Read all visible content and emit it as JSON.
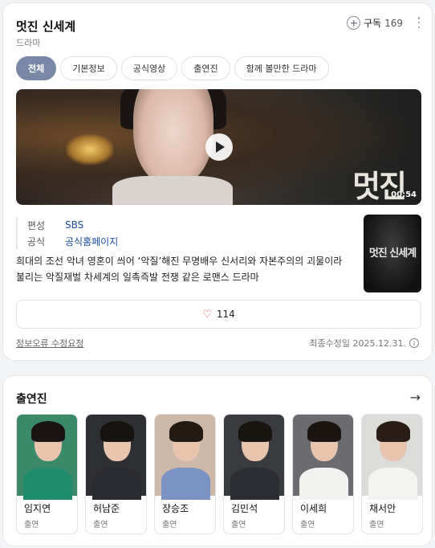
{
  "header": {
    "title": "멋진 신세계",
    "subtitle": "드라마",
    "subscribe_label": "구독",
    "subscribe_count": "169"
  },
  "tabs": [
    "전체",
    "기본정보",
    "공식영상",
    "출연진",
    "함께 볼만한 드라마"
  ],
  "active_tab": "전체",
  "video": {
    "duration": "00:54",
    "overlay_title": "멋진"
  },
  "info": [
    {
      "key": "편성",
      "value": "SBS"
    },
    {
      "key": "공식",
      "value": "공식홈페이지"
    }
  ],
  "poster_title": "멋진 신세계",
  "description": "희대의 조선 악녀 영혼이 씌어 ‘악질’해진 무명배우 신서리와 자본주의의 괴물이라 불리는 악질재벌 차세계의 일촉즉발 전쟁 같은 로맨스 드라마",
  "like_count": "114",
  "footer": {
    "report": "정보오류 수정요청",
    "updated": "최종수정일 2025.12.31."
  },
  "cast_section": {
    "title": "출연진",
    "members": [
      {
        "name": "임지연",
        "role": "출연",
        "bg": "#3a8a6a",
        "body": "#1f8c6c",
        "hair": "#1a1412"
      },
      {
        "name": "허남준",
        "role": "출연",
        "bg": "#2e2f33",
        "body": "#2a2b30",
        "hair": "#15120f"
      },
      {
        "name": "장승조",
        "role": "출연",
        "bg": "#ceb9a8",
        "body": "#7a93c2",
        "hair": "#231a14"
      },
      {
        "name": "김민석",
        "role": "출연",
        "bg": "#3a3b3f",
        "body": "#2d2e33",
        "hair": "#18140f"
      },
      {
        "name": "이세희",
        "role": "출연",
        "bg": "#6c6c70",
        "body": "#f2f2f0",
        "hair": "#1b1512"
      },
      {
        "name": "채서안",
        "role": "출연",
        "bg": "#dcdcda",
        "body": "#f4f4f2",
        "hair": "#2a1d16"
      }
    ]
  }
}
